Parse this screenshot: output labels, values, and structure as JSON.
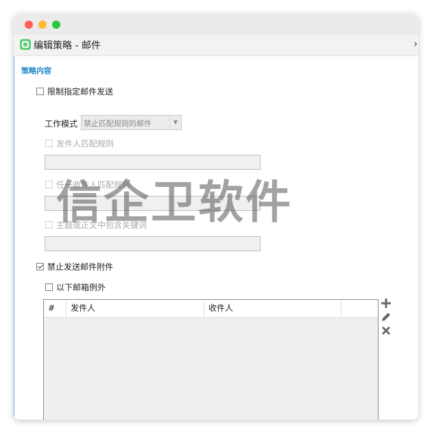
{
  "window": {
    "title": "编辑策略 - 邮件",
    "chevron": "›"
  },
  "section": {
    "title": "策略内容"
  },
  "restrict": {
    "label": "限制指定邮件发送",
    "checked": false
  },
  "work_mode": {
    "label": "工作模式",
    "value": "禁止匹配规则的邮件"
  },
  "sender_rule": {
    "label": "发件人匹配规则",
    "value": ""
  },
  "recipient_rule": {
    "label": "任一收件人匹配规则",
    "value": ""
  },
  "keyword_rule": {
    "label": "主题或正文中包含关键词",
    "value": ""
  },
  "block_attachment": {
    "label": "禁止发送邮件附件",
    "checked": true
  },
  "exception": {
    "label": "以下邮箱例外",
    "checked": false
  },
  "table": {
    "columns": [
      "#",
      "发件人",
      "收件人",
      ""
    ],
    "rows": []
  },
  "actions": {
    "add_icon": "plus-icon",
    "edit_icon": "pencil-icon",
    "delete_icon": "x-icon"
  },
  "watermark": "信企卫软件",
  "colors": {
    "accent": "#1f86c8",
    "traffic_red": "#fe5f57",
    "traffic_yellow": "#febc2e",
    "traffic_green": "#28c840",
    "app_icon": "#5fcf7a"
  }
}
